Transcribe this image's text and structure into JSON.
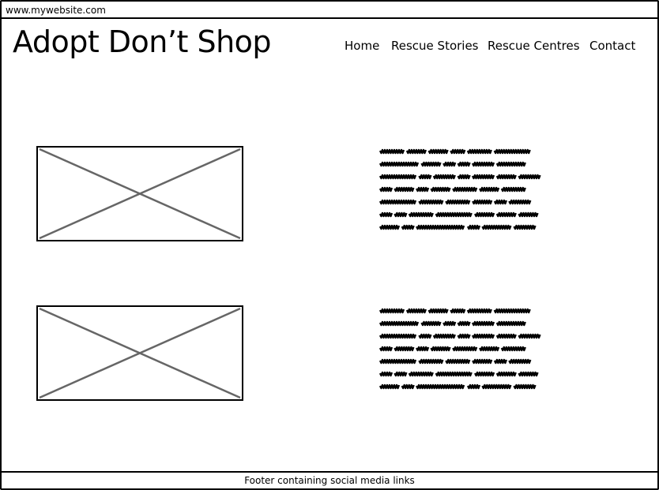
{
  "browser": {
    "url": "www.mywebsite.com"
  },
  "header": {
    "title": "Adopt Don’t Shop",
    "nav": [
      {
        "label": "Home"
      },
      {
        "label": "Rescue Stories"
      },
      {
        "label": "Rescue Centres"
      },
      {
        "label": "Contact"
      }
    ]
  },
  "main": {
    "rows": [
      {
        "image": "image-placeholder",
        "text": "scribble-placeholder"
      },
      {
        "image": "image-placeholder",
        "text": "scribble-placeholder"
      }
    ]
  },
  "footer": {
    "text": "Footer containing social media links"
  },
  "colors": {
    "stroke": "#000000",
    "placeholder_cross": "#666666"
  }
}
